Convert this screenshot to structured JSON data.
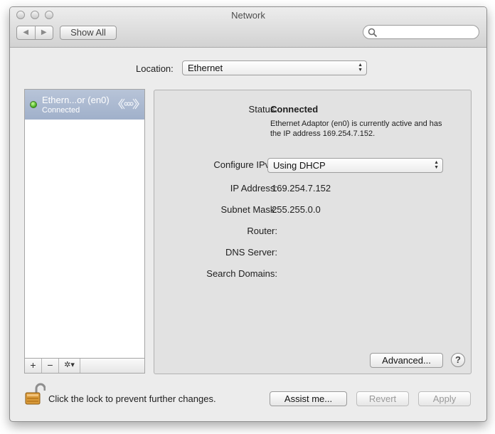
{
  "window": {
    "title": "Network"
  },
  "toolbar": {
    "back_icon": "back-arrow-icon",
    "forward_icon": "forward-arrow-icon",
    "show_all_label": "Show All",
    "search_placeholder": ""
  },
  "location": {
    "label": "Location:",
    "value": "Ethernet"
  },
  "sidebar": {
    "services": [
      {
        "name": "Ethern...or (en0)",
        "status": "Connected",
        "status_color": "#3fa91a",
        "icon": "ethernet-icon"
      }
    ],
    "buttons": {
      "add": "+",
      "remove": "−",
      "gear": "✲▾"
    }
  },
  "detail": {
    "status_label": "Status:",
    "status_value": "Connected",
    "status_description": "Ethernet Adaptor (en0) is currently active and has the IP address 169.254.7.152.",
    "configure_label": "Configure IPv4:",
    "configure_value": "Using DHCP",
    "ip_label": "IP Address:",
    "ip_value": "169.254.7.152",
    "subnet_label": "Subnet Mask:",
    "subnet_value": "255.255.0.0",
    "router_label": "Router:",
    "router_value": "",
    "dns_label": "DNS Server:",
    "dns_value": "",
    "search_domains_label": "Search Domains:",
    "search_domains_value": "",
    "advanced_label": "Advanced...",
    "help_label": "?"
  },
  "footer": {
    "lock_text": "Click the lock to prevent further changes.",
    "assist_label": "Assist me...",
    "revert_label": "Revert",
    "apply_label": "Apply"
  }
}
